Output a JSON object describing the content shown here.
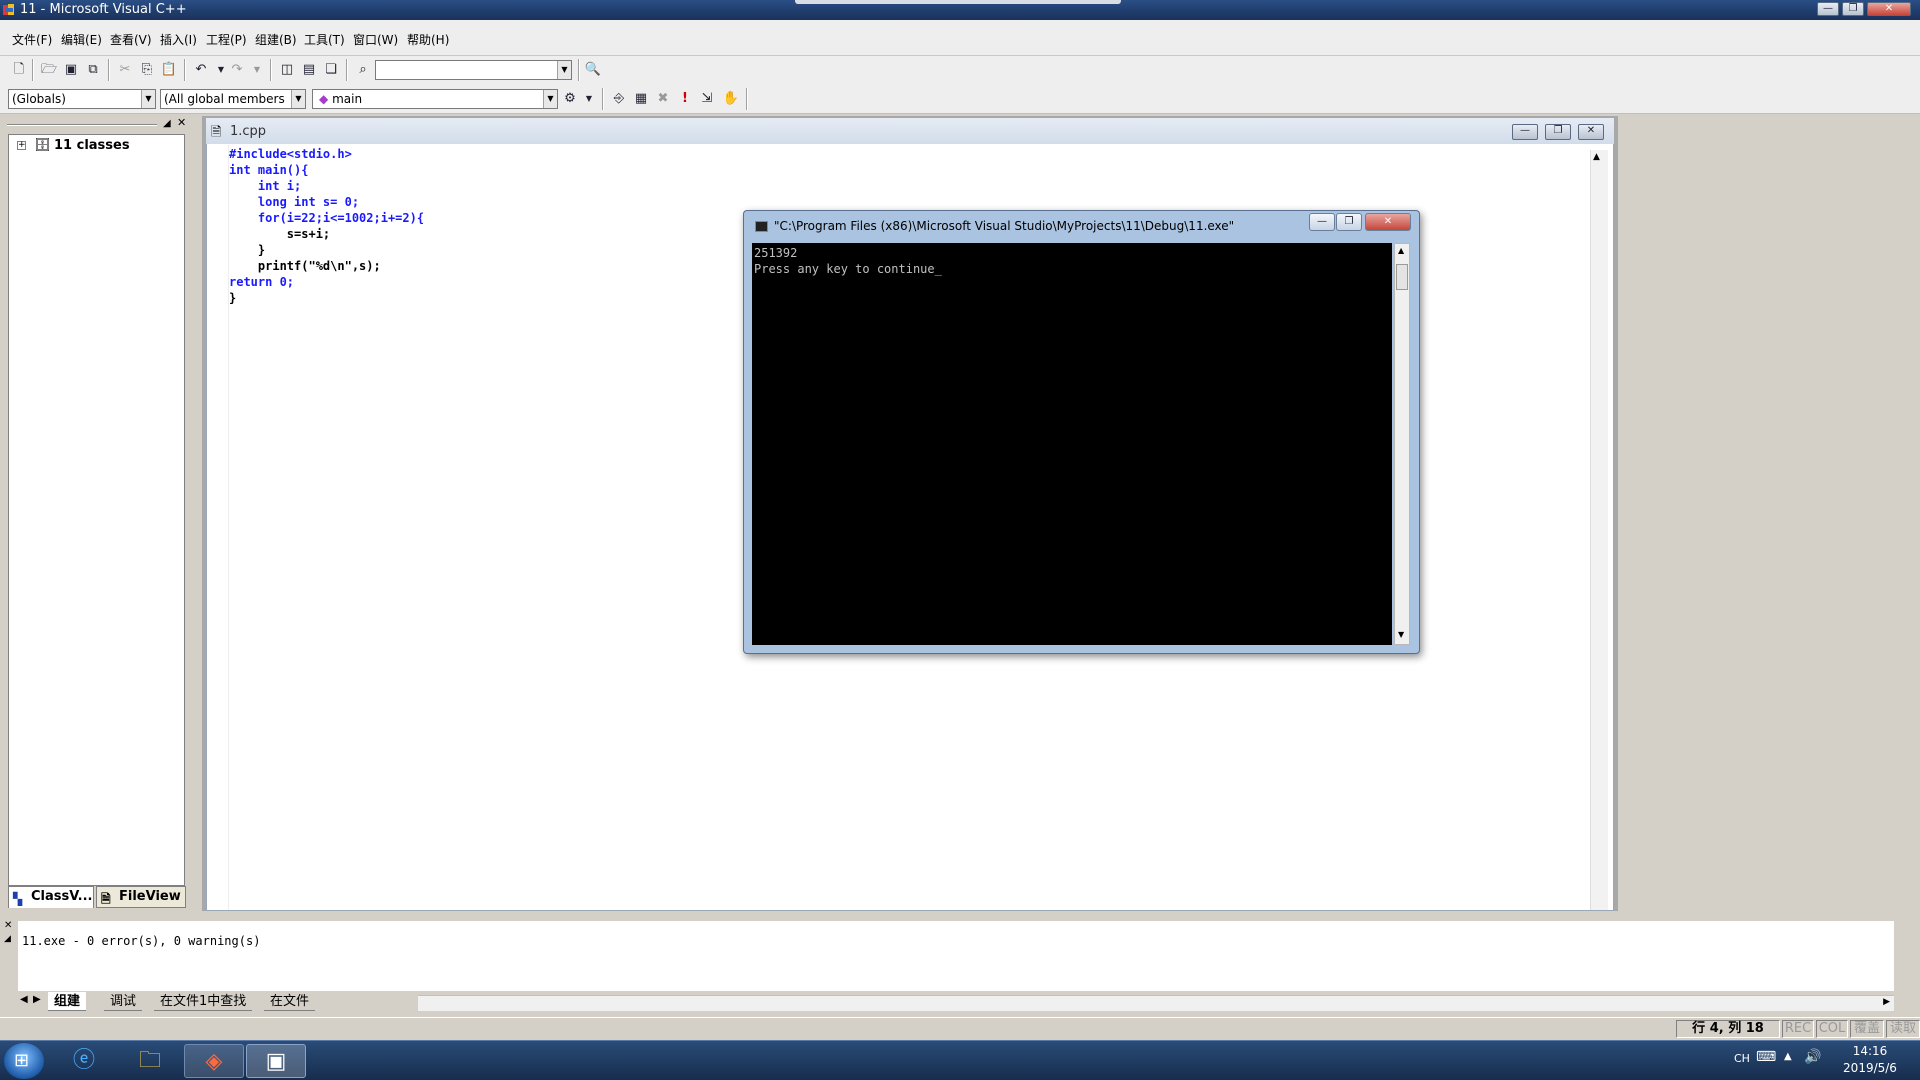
{
  "window": {
    "title": "11 - Microsoft Visual C++"
  },
  "menu": [
    "文件(F)",
    "编辑(E)",
    "查看(V)",
    "插入(I)",
    "工程(P)",
    "组建(B)",
    "工具(T)",
    "窗口(W)",
    "帮助(H)"
  ],
  "wizard_bar": {
    "scope": "(Globals)",
    "members": "(All global members",
    "function": "main"
  },
  "class_view": {
    "root_label": "11 classes",
    "tabs": [
      "ClassV...",
      "FileView"
    ]
  },
  "editor": {
    "file_tab": "1.cpp",
    "code_lines": [
      "#include<stdio.h>",
      "int main(){",
      "    int i;",
      "    long int s= 0;",
      "    for(i=22;i<=1002;i+=2){",
      "        s=s+i;",
      "    }",
      "    printf(\"%d\\n\",s);",
      "return 0;",
      "}"
    ]
  },
  "console": {
    "title": "\"C:\\Program Files (x86)\\Microsoft Visual Studio\\MyProjects\\11\\Debug\\11.exe\"",
    "lines": [
      "251392",
      "Press any key to continue_"
    ]
  },
  "output": {
    "message": "11.exe - 0 error(s), 0 warning(s)",
    "tabs": [
      "组建",
      "调试",
      "在文件1中查找",
      "在文件"
    ]
  },
  "status": {
    "position": "行 4, 列 18",
    "indicators": [
      "REC",
      "COL",
      "覆盖",
      "读取"
    ]
  },
  "taskbar": {
    "lang": "CH",
    "time": "14:16",
    "date": "2019/5/6"
  },
  "colors": {
    "keyword": "#1a1aff",
    "console_bg": "#000000",
    "taskbar": "#1f3a60"
  },
  "icons": [
    "new-file-icon",
    "open-folder-icon",
    "save-icon",
    "save-all-icon",
    "cut-icon",
    "copy-icon",
    "paste-icon",
    "undo-icon",
    "redo-icon",
    "workspace-icon",
    "output-icon",
    "window-list-icon",
    "find-in-files-icon",
    "find-icon",
    "compile-icon",
    "build-icon",
    "stop-build-icon",
    "execute-icon",
    "go-icon",
    "breakpoint-icon"
  ]
}
